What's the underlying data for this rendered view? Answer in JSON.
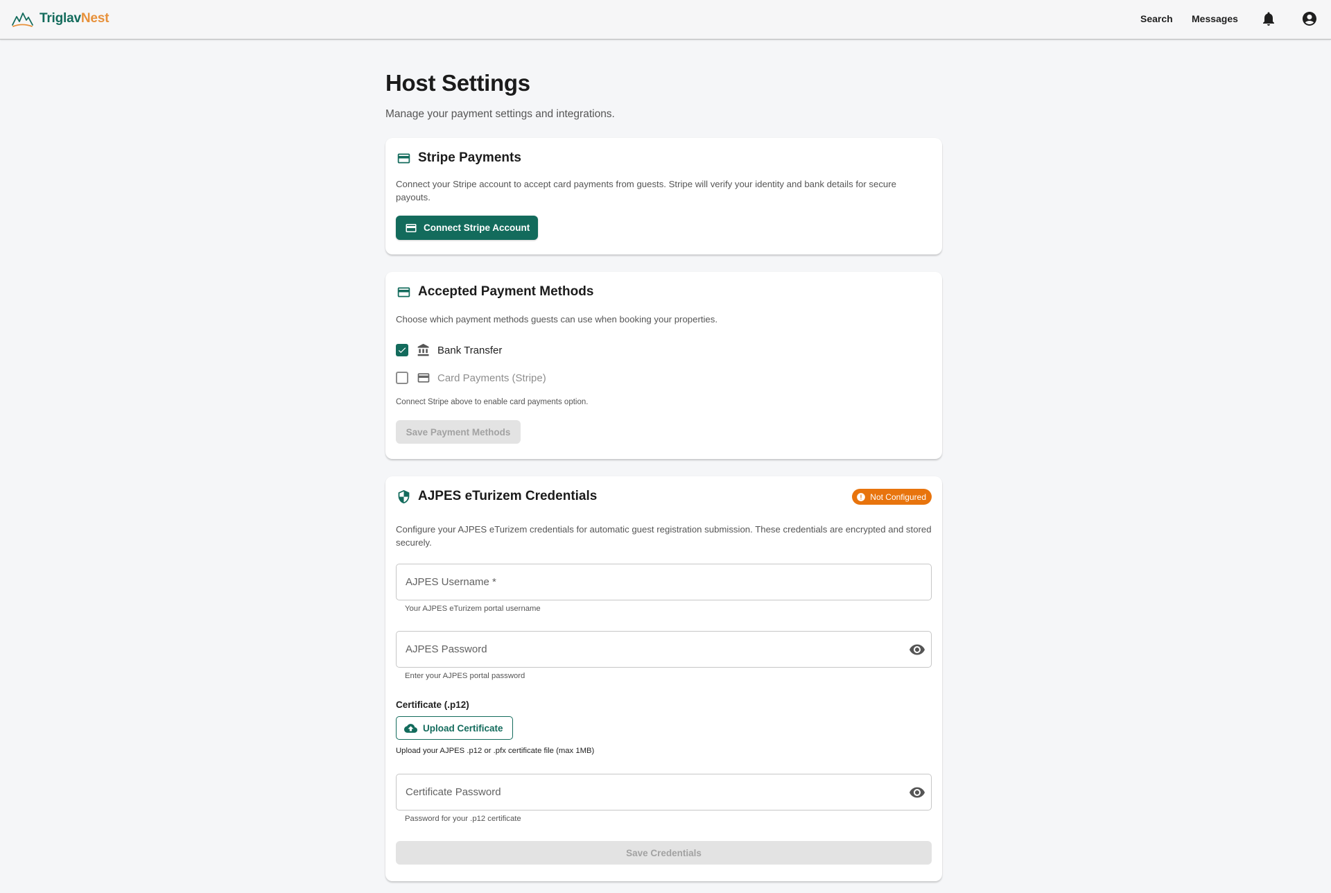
{
  "header": {
    "brand_part1": "Triglav",
    "brand_part2": "Nest",
    "nav_search": "Search",
    "nav_messages": "Messages",
    "icons": [
      "mountain-logo-icon",
      "bell-icon",
      "account-circle-icon"
    ]
  },
  "page": {
    "title": "Host Settings",
    "subtitle": "Manage your payment settings and integrations."
  },
  "stripe": {
    "title": "Stripe Payments",
    "description": "Connect your Stripe account to accept card payments from guests. Stripe will verify your identity and bank details for secure payouts.",
    "button_label": "Connect Stripe Account"
  },
  "methods": {
    "title": "Accepted Payment Methods",
    "description": "Choose which payment methods guests can use when booking your properties.",
    "options": [
      {
        "label": "Bank Transfer",
        "checked": true,
        "icon": "bank-icon"
      },
      {
        "label": "Card Payments (Stripe)",
        "checked": false,
        "icon": "credit-card-icon"
      }
    ],
    "hint": "Connect Stripe above to enable card payments option.",
    "save_label": "Save Payment Methods"
  },
  "ajpes": {
    "title": "AJPES eTurizem Credentials",
    "badge": "Not Configured",
    "description": "Configure your AJPES eTurizem credentials for automatic guest registration submission. These credentials are encrypted and stored securely.",
    "username_label": "AJPES Username *",
    "username_help": "Your AJPES eTurizem portal username",
    "password_label": "AJPES Password",
    "password_help": "Enter your AJPES portal password",
    "certificate_label": "Certificate (.p12)",
    "upload_label": "Upload Certificate",
    "upload_help": "Upload your AJPES .p12 or .pfx certificate file (max 1MB)",
    "cert_password_label": "Certificate Password",
    "cert_password_help": "Password for your .p12 certificate",
    "save_label": "Save Credentials"
  },
  "colors": {
    "primary": "#136b5c",
    "accent": "#e7913b",
    "warning": "#e8740d",
    "background": "#f5f6f8",
    "disabled": "#e3e3e3"
  }
}
